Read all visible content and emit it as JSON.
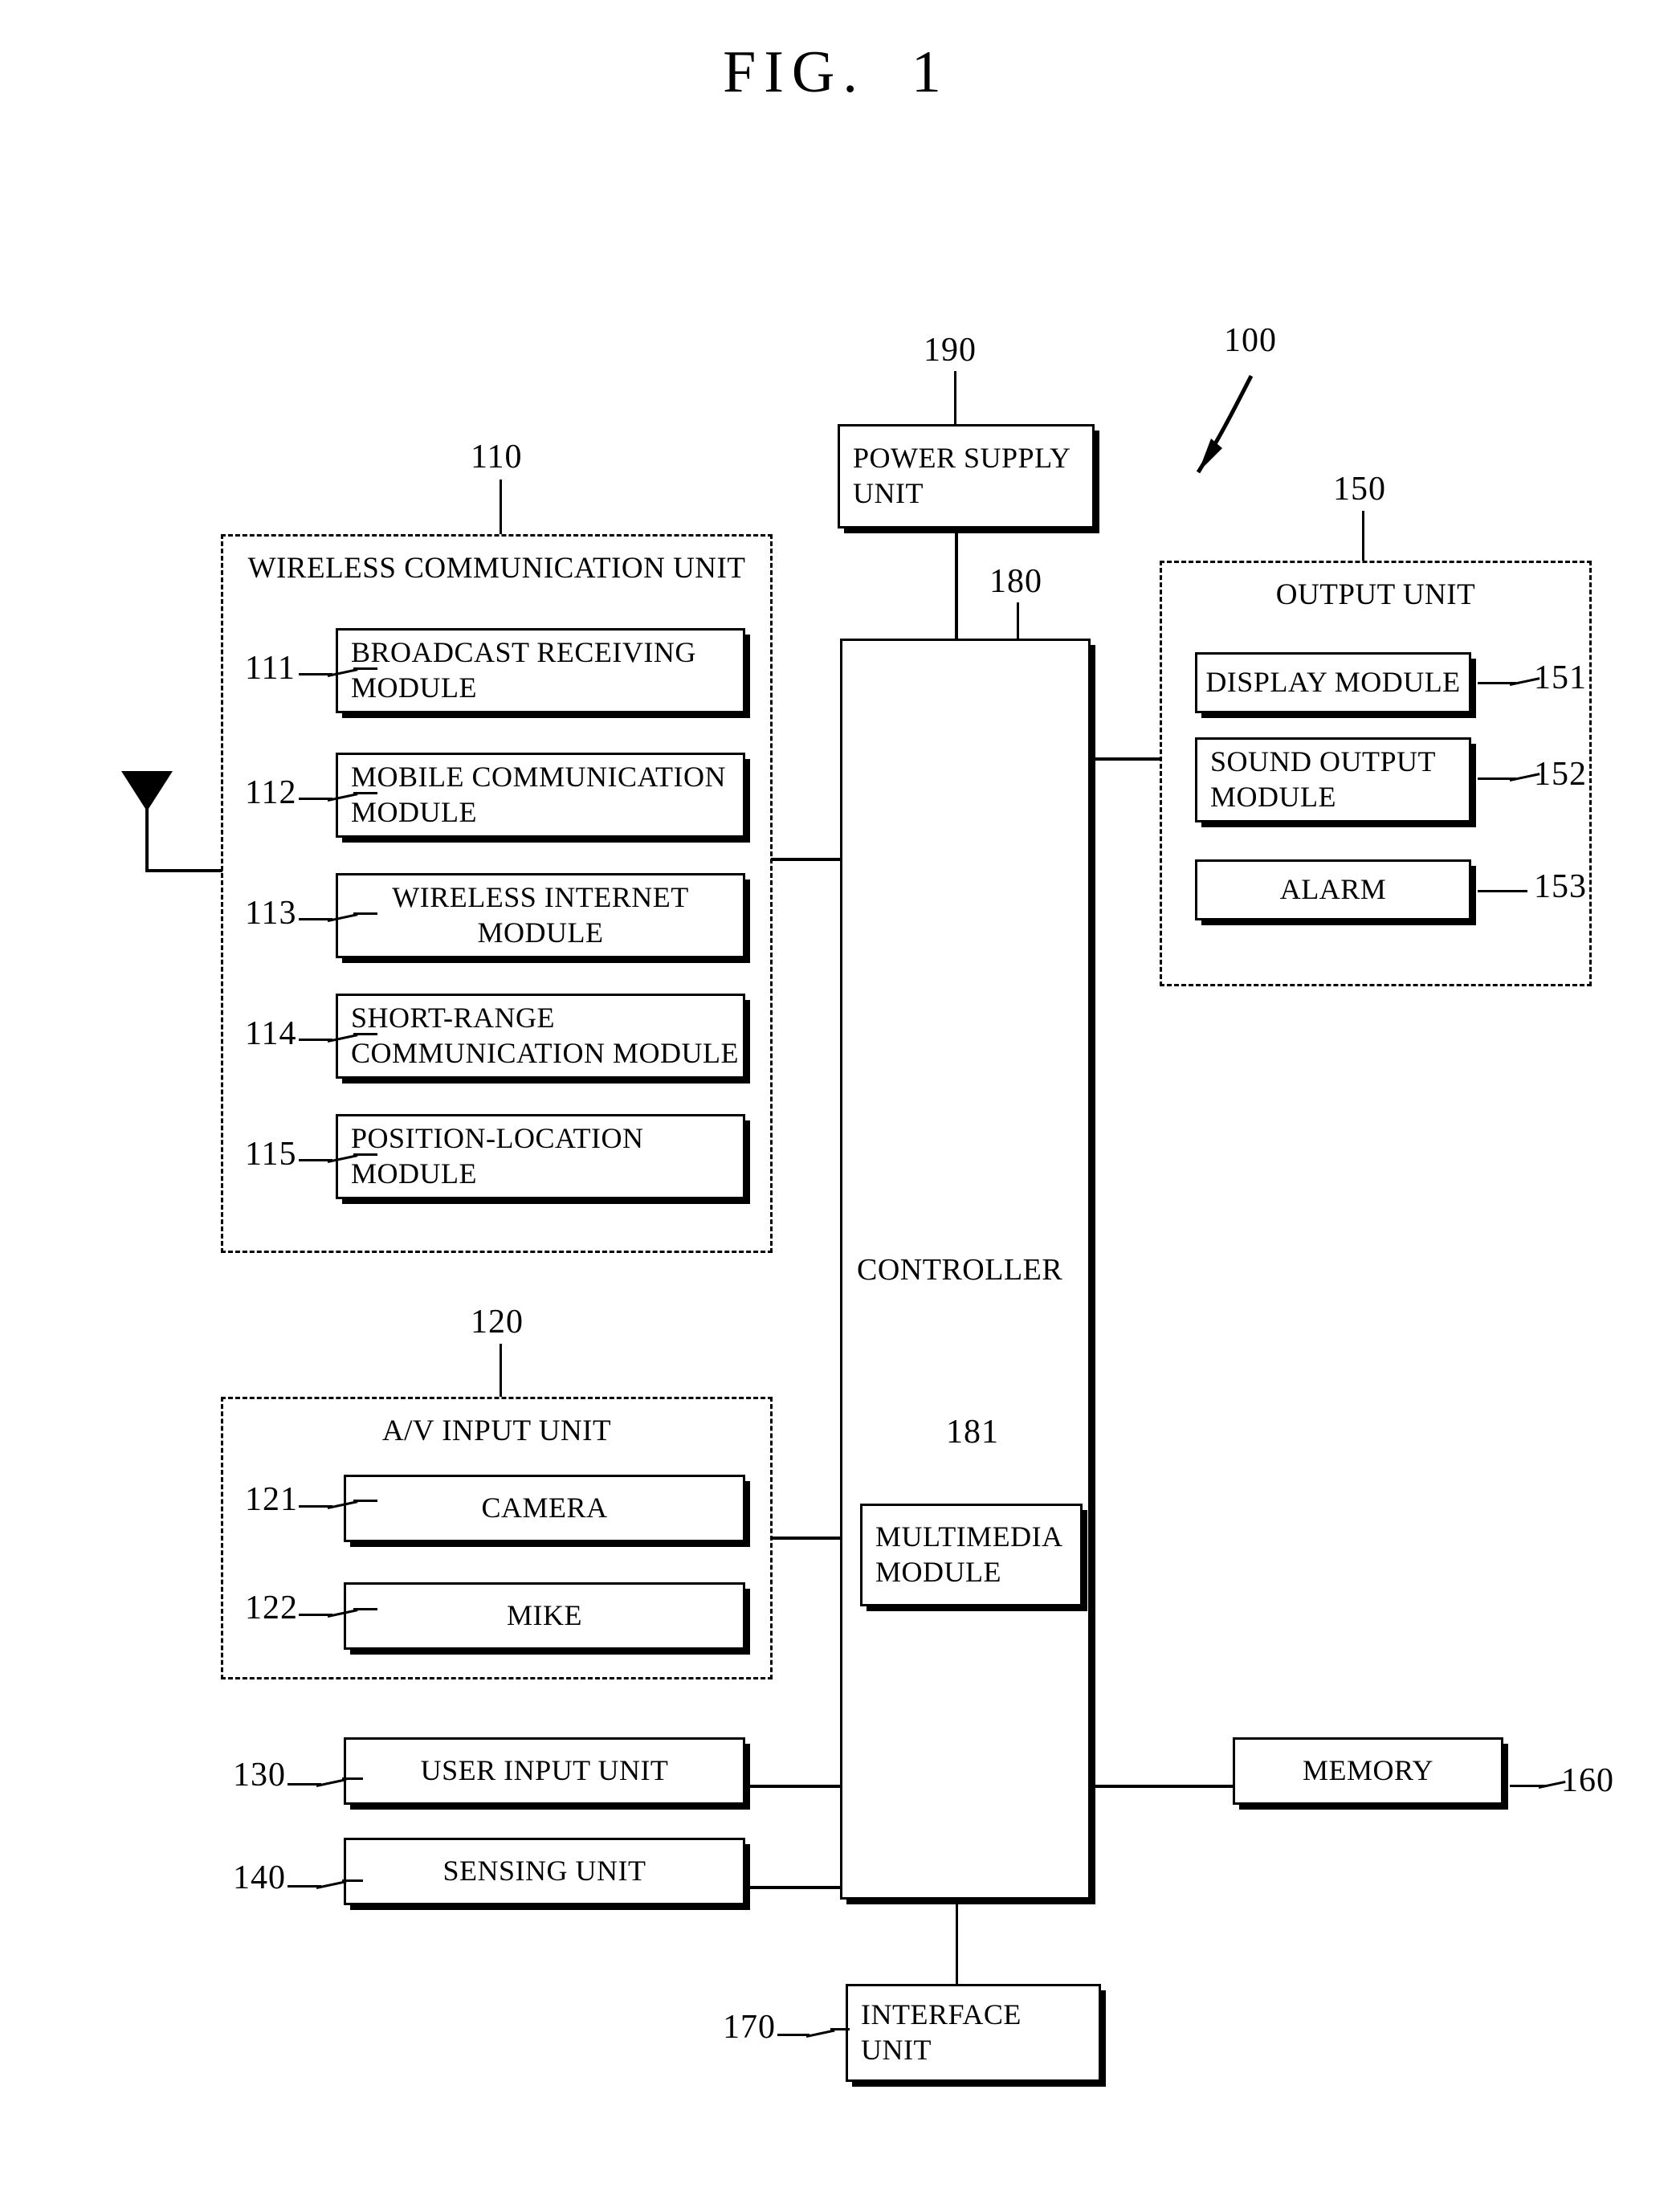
{
  "figure": {
    "title": "FIG.  1",
    "device_ref": "100"
  },
  "power_supply": {
    "ref": "190",
    "label": "POWER SUPPLY\nUNIT"
  },
  "controller": {
    "ref": "180",
    "label": "CONTROLLER",
    "multimedia": {
      "ref": "181",
      "label": "MULTIMEDIA\nMODULE"
    }
  },
  "wireless_communication_unit": {
    "ref": "110",
    "title": "WIRELESS COMMUNICATION UNIT",
    "modules": [
      {
        "ref": "111",
        "label": "BROADCAST RECEIVING\nMODULE",
        "align": "left"
      },
      {
        "ref": "112",
        "label": "MOBILE COMMUNICATION\nMODULE",
        "align": "left"
      },
      {
        "ref": "113",
        "label": "WIRELESS INTERNET\nMODULE",
        "align": "center"
      },
      {
        "ref": "114",
        "label": "SHORT-RANGE\nCOMMUNICATION  MODULE",
        "align": "left"
      },
      {
        "ref": "115",
        "label": "POSITION-LOCATION\nMODULE",
        "align": "left"
      }
    ]
  },
  "av_input_unit": {
    "ref": "120",
    "title": "A/V INPUT UNIT",
    "modules": [
      {
        "ref": "121",
        "label": "CAMERA",
        "align": "center"
      },
      {
        "ref": "122",
        "label": "MIKE",
        "align": "center"
      }
    ]
  },
  "output_unit": {
    "ref": "150",
    "title": "OUTPUT UNIT",
    "modules": [
      {
        "ref": "151",
        "label": "DISPLAY MODULE",
        "align": "center"
      },
      {
        "ref": "152",
        "label": "SOUND OUTPUT\nMODULE",
        "align": "left"
      },
      {
        "ref": "153",
        "label": "ALARM",
        "align": "center"
      }
    ]
  },
  "user_input_unit": {
    "ref": "130",
    "label": "USER INPUT UNIT"
  },
  "sensing_unit": {
    "ref": "140",
    "label": "SENSING UNIT"
  },
  "memory": {
    "ref": "160",
    "label": "MEMORY"
  },
  "interface_unit": {
    "ref": "170",
    "label": "INTERFACE\nUNIT"
  },
  "colors": {
    "ink": "#000000",
    "paper": "#ffffff"
  }
}
